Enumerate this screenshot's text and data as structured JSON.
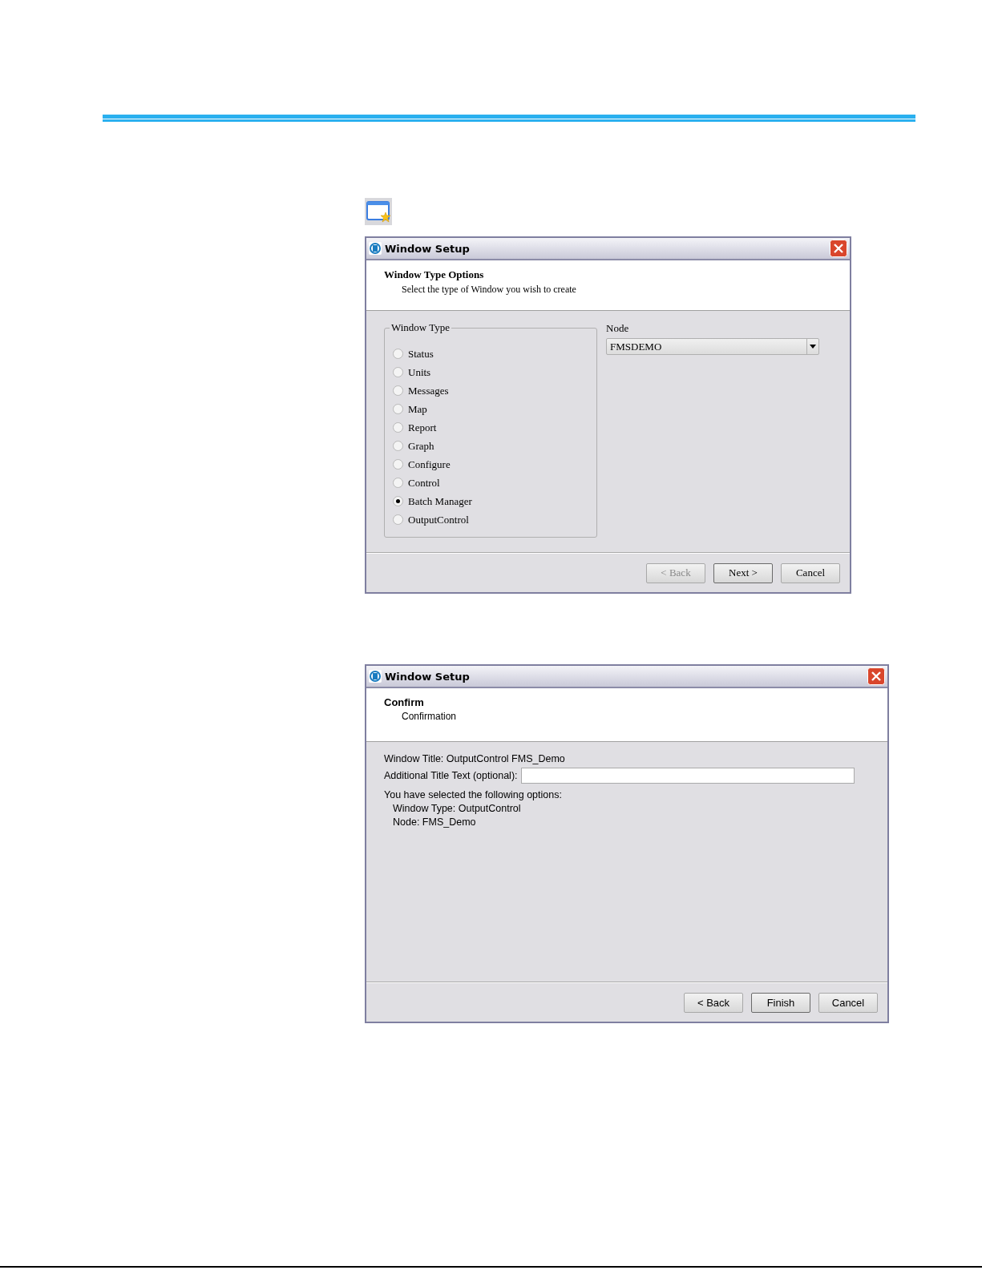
{
  "dialogs": [
    {
      "kind": "options",
      "title": "Window Setup",
      "heading": "Window Type Options",
      "subheading": "Select the type of Window you wish to create",
      "group": {
        "label": "Window Type",
        "options": [
          {
            "label": "Status",
            "selected": false
          },
          {
            "label": "Units",
            "selected": false
          },
          {
            "label": "Messages",
            "selected": false
          },
          {
            "label": "Map",
            "selected": false
          },
          {
            "label": "Report",
            "selected": false
          },
          {
            "label": "Graph",
            "selected": false
          },
          {
            "label": "Configure",
            "selected": false
          },
          {
            "label": "Control",
            "selected": false
          },
          {
            "label": "Batch Manager",
            "selected": true
          },
          {
            "label": "OutputControl",
            "selected": false
          }
        ]
      },
      "node": {
        "label": "Node",
        "value": "FMSDEMO"
      },
      "buttons": [
        {
          "label": "< Back",
          "disabled": true,
          "default": false
        },
        {
          "label": "Next >",
          "disabled": false,
          "default": true
        },
        {
          "label": "Cancel",
          "disabled": false,
          "default": false
        }
      ]
    },
    {
      "kind": "confirm",
      "title": "Window Setup",
      "heading": "Confirm",
      "subheading": "Confirmation",
      "window_title": "Window Title: OutputControl FMS_Demo",
      "field": {
        "label": "Additional Title Text (optional):"
      },
      "summary": [
        "You have selected the following options:",
        "Window Type: OutputControl",
        "Node: FMS_Demo"
      ],
      "buttons": [
        {
          "label": "< Back",
          "disabled": false,
          "default": false
        },
        {
          "label": "Finish",
          "disabled": false,
          "default": true
        },
        {
          "label": "Cancel",
          "disabled": false,
          "default": false
        }
      ]
    }
  ]
}
